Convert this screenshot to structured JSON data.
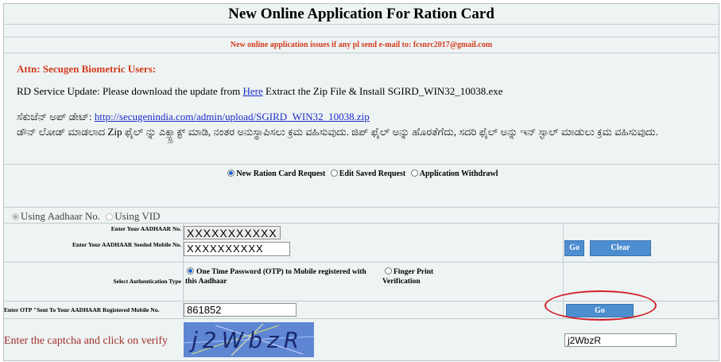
{
  "header": {
    "title": "New Online Application For Ration Card"
  },
  "notice": {
    "text": "New online application issues if any pl send e-mail to: fcsnrc2017@gmail.com"
  },
  "attn": {
    "heading": "Attn: Secugen Biometric Users:",
    "rd_prefix": "RD Service Update: Please download the update from",
    "rd_link": "Here",
    "rd_suffix": "Extract the Zip File & Install SGIRD_WIN32_10038.exe",
    "kannada_label": "ಸೆಕುಜೆನ್ ಅಪ್ ಡೇಟ್:",
    "kannada_link": "http://secugenindia.com/admin/upload/SGIRD_WIN32_10038.zip",
    "kannada_text": "ಡೌನ್ ಲೋಡ್ ಮಾಡಲಾದ Zip ಫೈಲ್ ನ್ನು ಎಕ್ಸ್ಟ್ರಾಕ್ಟ್ ಮಾಡಿ, ನಂತರ ಅನುಸ್ಥಾಪಿಸಲು ಕ್ರಮ ವಹಿಸುವುದು. ಜಿಪ್ ಫೈಲ್ ಅನ್ನು ಹೊರತೆಗೆದು, ಸದರಿ ಫೈಲ್ ಅನ್ನು ಇನ್ ಸ್ಟಾಲ್ ಮಾಡುಲು ಕ್ರಮ ವಹಿಸುವುದು."
  },
  "request_options": [
    {
      "label": "New Ration Card Request",
      "selected": true
    },
    {
      "label": "Edit Saved Request",
      "selected": false
    },
    {
      "label": "Application Withdrawl",
      "selected": false
    }
  ],
  "id_mode": [
    {
      "label": "Using Aadhaar No.",
      "selected": true
    },
    {
      "label": "Using VID",
      "selected": false
    }
  ],
  "form": {
    "aadhaar_label": "Enter Your AADHAAR No.",
    "aadhaar_value": "XXXXXXXXXXX",
    "mobile_label": "Enter Your AADHAAR Seeded Mobile No.",
    "mobile_value": "XXXXXXXXXX",
    "go_label": "Go",
    "clear_label": "Clear",
    "auth_label": "Select Authentication Type",
    "auth_otp": "One Time Password (OTP) to Mobile registered with this Aadhaar",
    "auth_finger": "Finger Print Verification",
    "otp_label": "Enter OTP \"Sent To Your AADHAAR Registered Mobile No.",
    "otp_value": "861852",
    "otp_go_label": "Go",
    "captcha_label": "Enter the captcha and click on verify",
    "captcha_text": "j2WbzR",
    "captcha_input": "j2WbzR"
  },
  "colors": {
    "accent": "#4d8ed0",
    "notice": "#d43a1c",
    "highlight": "#d2202a"
  }
}
